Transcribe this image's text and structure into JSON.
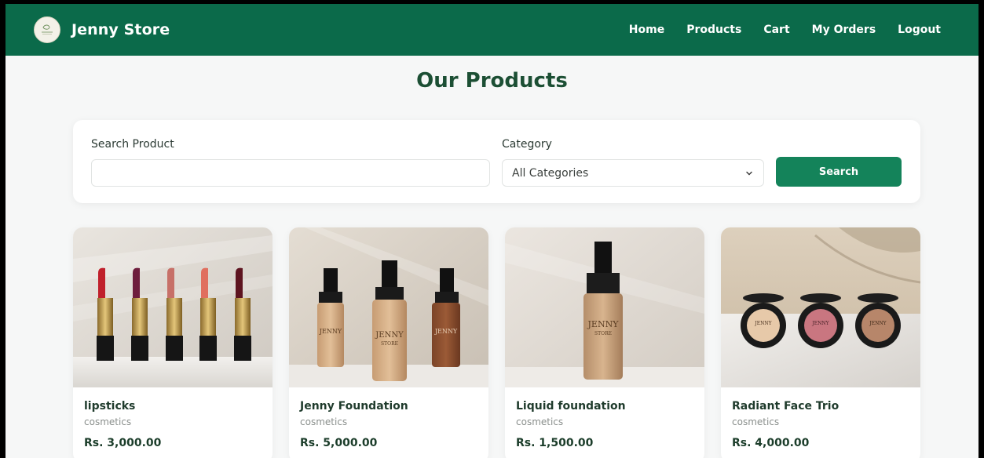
{
  "header": {
    "brand": "Jenny Store",
    "nav": [
      "Home",
      "Products",
      "Cart",
      "My Orders",
      "Logout"
    ]
  },
  "page": {
    "title": "Our Products"
  },
  "search": {
    "product_label": "Search Product",
    "product_value": "",
    "category_label": "Category",
    "category_value": "All Categories",
    "button_label": "Search"
  },
  "products": [
    {
      "name": "lipsticks",
      "category": "cosmetics",
      "price": "Rs. 3,000.00"
    },
    {
      "name": "Jenny Foundation",
      "category": "cosmetics",
      "price": "Rs. 5,000.00"
    },
    {
      "name": "Liquid foundation",
      "category": "cosmetics",
      "price": "Rs. 1,500.00"
    },
    {
      "name": "Radiant Face Trio",
      "category": "cosmetics",
      "price": "Rs. 4,000.00"
    }
  ],
  "images": {
    "brand_text": "JENNY",
    "brand_sub": "STORE"
  },
  "colors": {
    "primary": "#0b6a4a",
    "button": "#14835a",
    "title": "#1c4f34"
  },
  "icons": {
    "logo": "store-logo-icon",
    "select": "chevron-down-icon"
  }
}
